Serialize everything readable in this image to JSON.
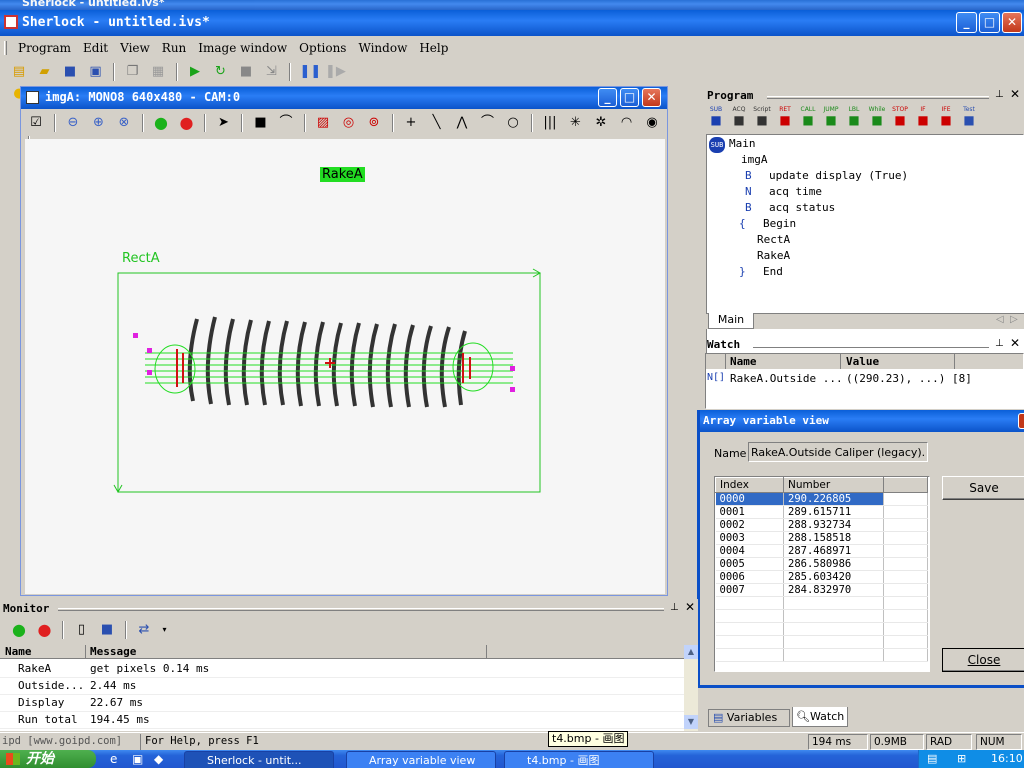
{
  "bg_window_title": "Sherlock - untitled.ivs*",
  "app": {
    "title": "Sherlock - untitled.ivs*",
    "min": "_",
    "max": "□",
    "close": "✕"
  },
  "menu": [
    "Program",
    "Edit",
    "View",
    "Run",
    "Image window",
    "Options",
    "Window",
    "Help"
  ],
  "image_window": {
    "title": "imgA: MONO8 640x480 - CAM:0",
    "labels": {
      "rake": "RakeA",
      "rect": "RectA"
    }
  },
  "program_panel": {
    "title": "Program",
    "toolbar_labels": [
      "SUB",
      "ACQ",
      "Script",
      "RET",
      "CALL",
      "JUMP",
      "LBL",
      "While",
      "STOP",
      "IF",
      "IFE",
      "Test"
    ],
    "tree": [
      {
        "prefix": "SUB",
        "text": "Main"
      },
      {
        "prefix": "",
        "text": "imgA"
      },
      {
        "prefix": "B",
        "text": "update display (True)"
      },
      {
        "prefix": "N",
        "text": "acq time"
      },
      {
        "prefix": "B",
        "text": "acq status"
      },
      {
        "prefix": "{",
        "text": "Begin"
      },
      {
        "prefix": "",
        "text": "RectA"
      },
      {
        "prefix": "",
        "text": "RakeA"
      },
      {
        "prefix": "}",
        "text": "End"
      }
    ],
    "tab": "Main"
  },
  "watch_panel": {
    "title": "Watch",
    "columns": [
      "Name",
      "Value"
    ],
    "row": {
      "type": "N[]",
      "name": "RakeA.Outside ...",
      "value": "((290.23), ...) [8]"
    }
  },
  "array_dialog": {
    "title": "Array variable view",
    "name_label": "Name",
    "name_value": "RakeA.Outside Caliper (legacy).dist",
    "columns": [
      "Index",
      "Number"
    ],
    "rows": [
      [
        "0000",
        "290.226805"
      ],
      [
        "0001",
        "289.615711"
      ],
      [
        "0002",
        "288.932734"
      ],
      [
        "0003",
        "288.158518"
      ],
      [
        "0004",
        "287.468971"
      ],
      [
        "0005",
        "286.580986"
      ],
      [
        "0006",
        "285.603420"
      ],
      [
        "0007",
        "284.832970"
      ]
    ],
    "save": "Save",
    "close": "Close"
  },
  "monitor": {
    "title": "Monitor",
    "columns": [
      "Name",
      "Message"
    ],
    "rows": [
      [
        "RakeA",
        "get pixels 0.14 ms"
      ],
      [
        "Outside...",
        "2.44 ms"
      ],
      [
        "Display",
        "22.67 ms"
      ],
      [
        "Run total",
        "194.45 ms"
      ]
    ]
  },
  "bottom_tabs": {
    "variables": "Variables",
    "watch": "Watch"
  },
  "status": {
    "left": "ipd [www.goipd.com]",
    "help": "For Help, press F1",
    "time": "194 ms",
    "mem": "0.9MB",
    "rad": "RAD",
    "num": "NUM",
    "tooltip": "t4.bmp - 画图"
  },
  "taskbar": {
    "start": "开始",
    "tasks": [
      "Sherlock - untit...",
      "Array variable view",
      "t4.bmp - 画图"
    ],
    "clock": "16:10"
  },
  "colors": {
    "title_blue": "#0b5ad5",
    "overlay_green": "#22dd22",
    "select_blue": "#316ac5"
  }
}
